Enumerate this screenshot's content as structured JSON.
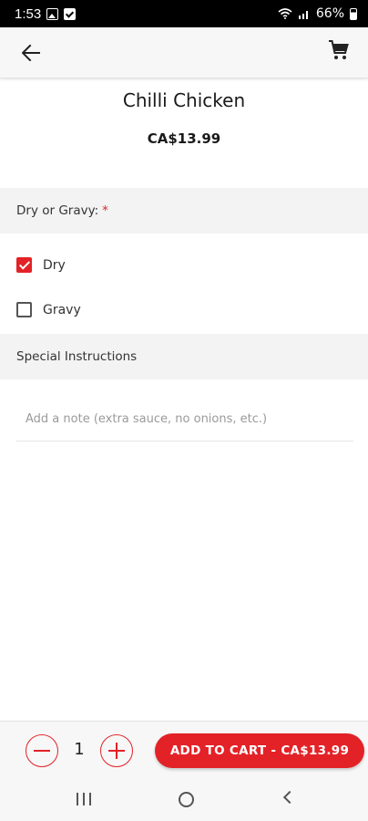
{
  "status_bar": {
    "time": "1:53",
    "battery": "66%",
    "icons": [
      "image-icon",
      "check-icon",
      "wifi-icon",
      "signal-icon",
      "battery-icon"
    ]
  },
  "toolbar": {
    "back_icon": "arrow-left-icon",
    "cart_icon": "shopping-cart-icon"
  },
  "item": {
    "title": "Chilli Chicken",
    "price": "CA$13.99"
  },
  "options_section": {
    "label": "Dry or Gravy:",
    "required_marker": "*",
    "options": [
      {
        "label": "Dry",
        "checked": true
      },
      {
        "label": "Gravy",
        "checked": false
      }
    ]
  },
  "notes_section": {
    "label": "Special Instructions",
    "placeholder": "Add a note (extra sauce, no onions, etc.)",
    "value": ""
  },
  "bottom_bar": {
    "quantity": "1",
    "add_to_cart_label": "ADD TO CART - CA$13.99"
  },
  "colors": {
    "accent": "#e32227",
    "section_bg": "#f3f3f3",
    "toolbar_bg": "#f7f7f7"
  }
}
